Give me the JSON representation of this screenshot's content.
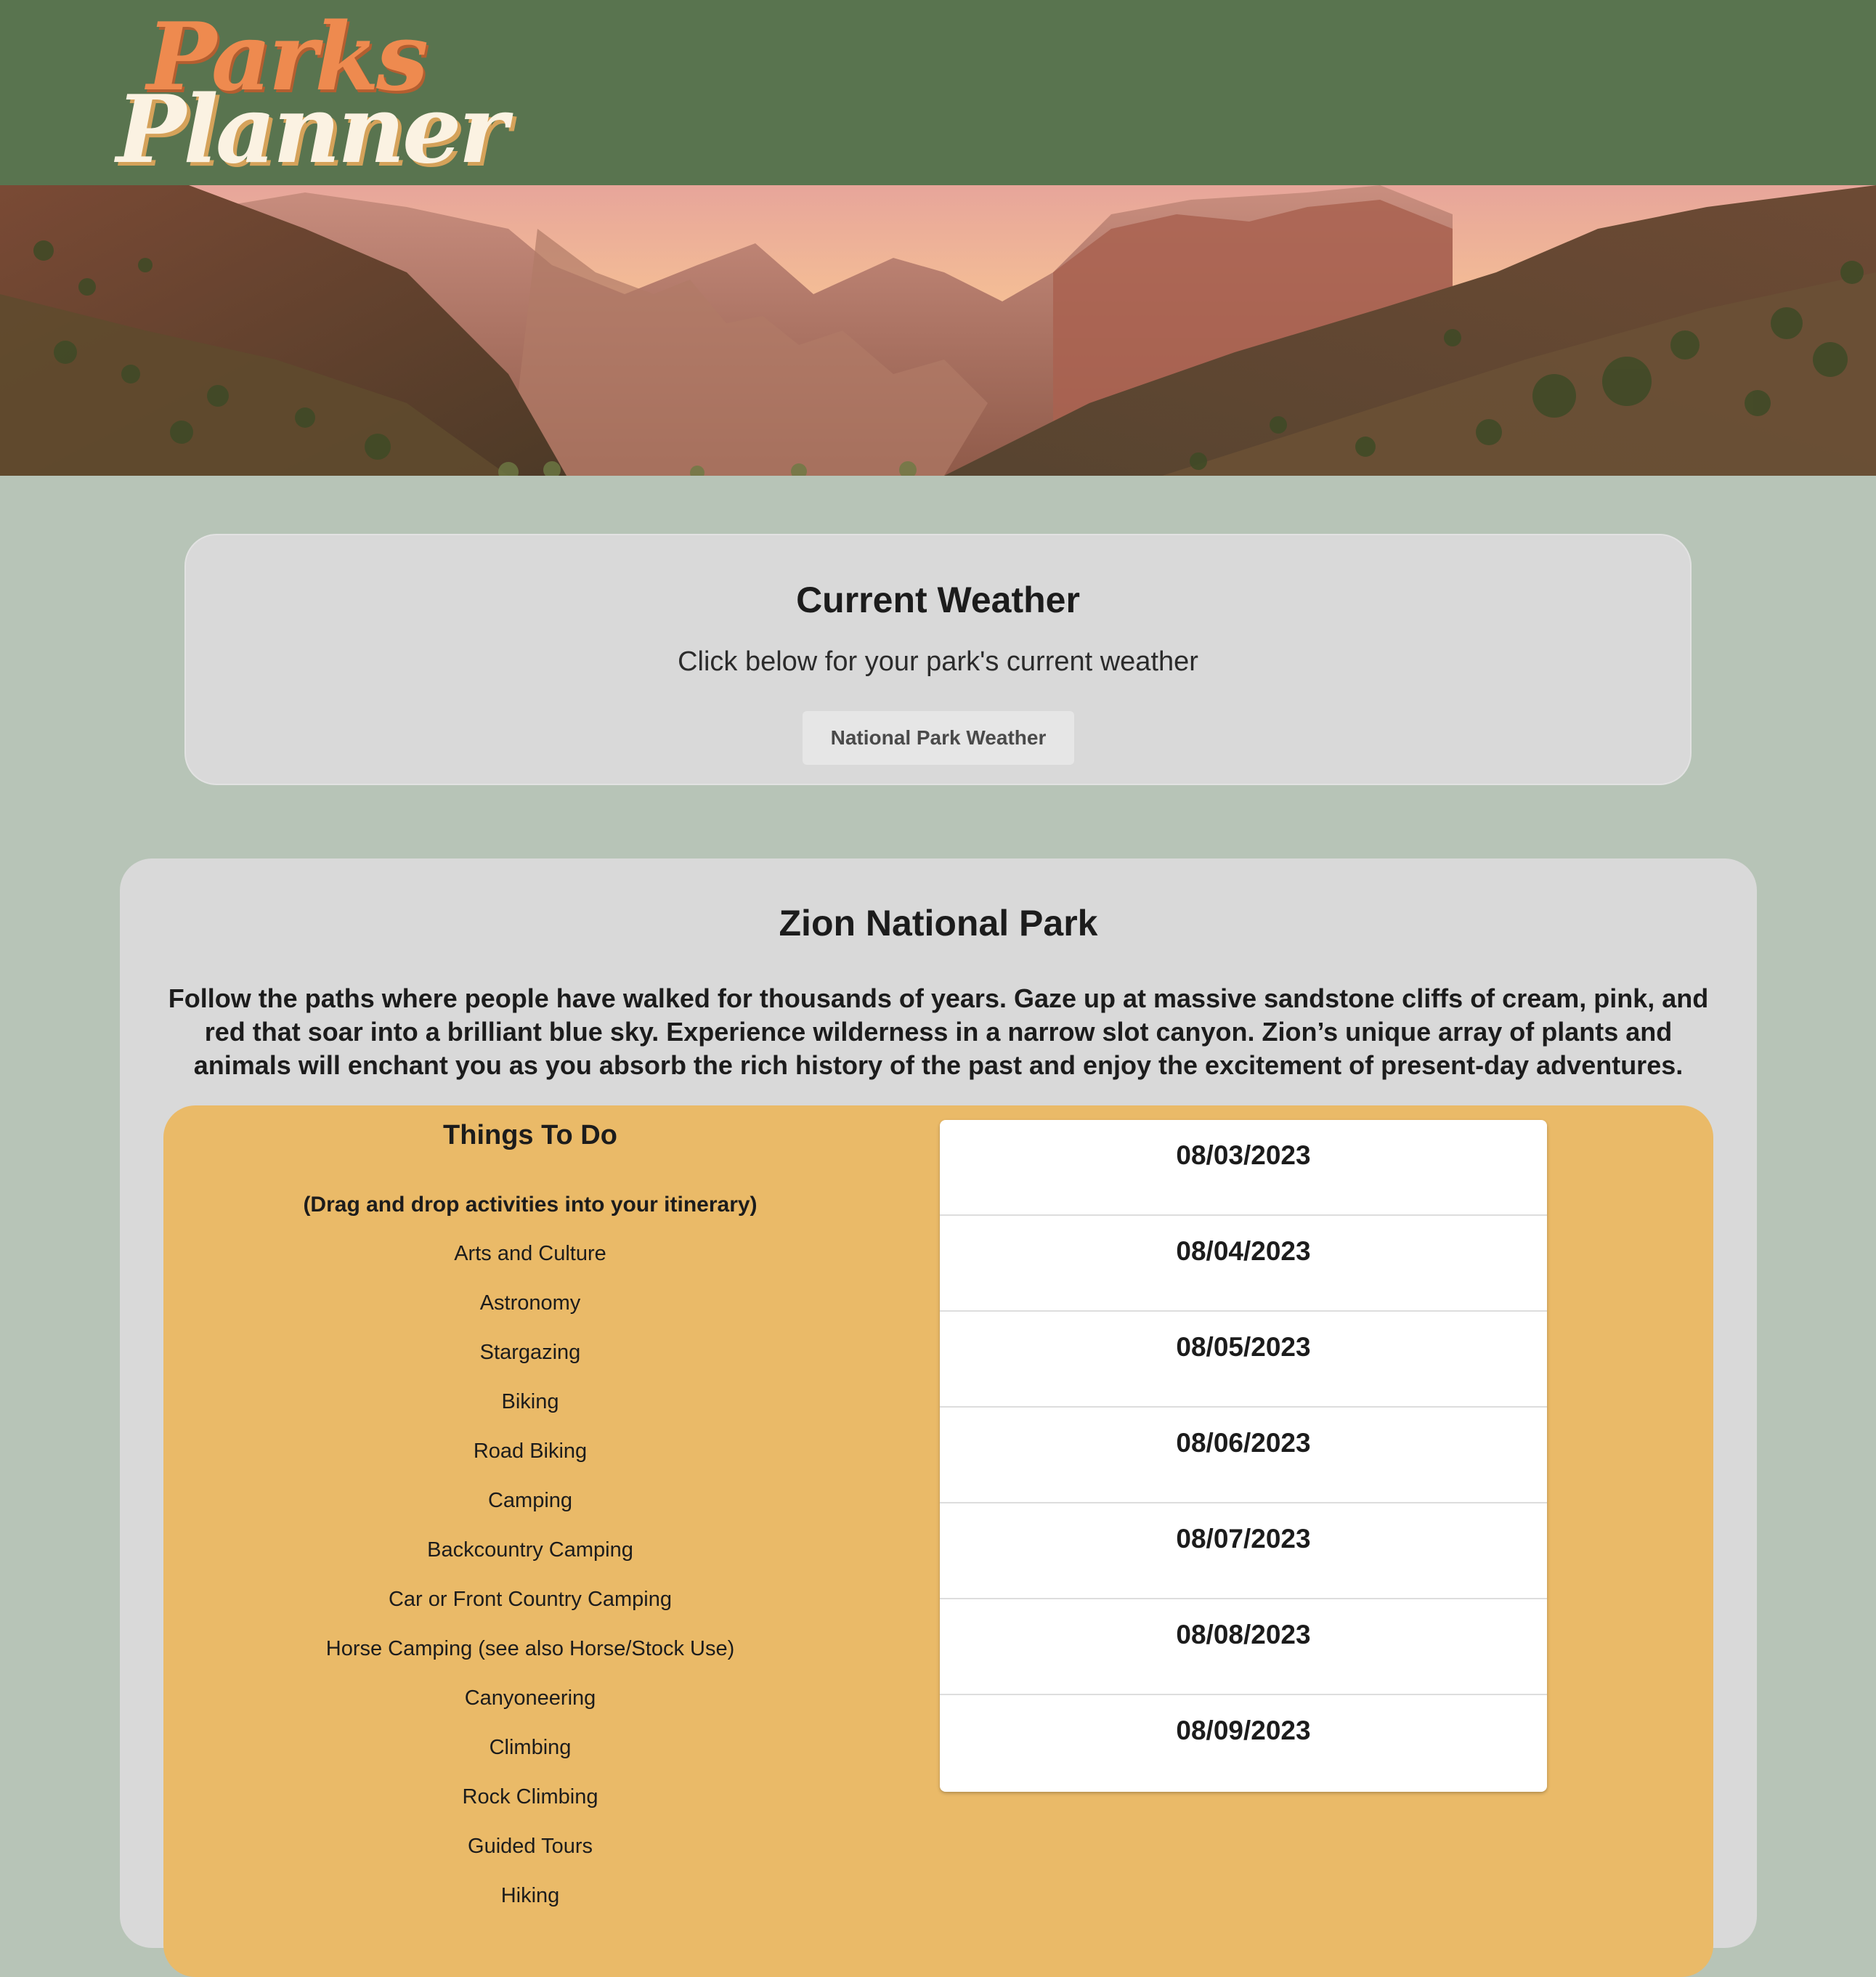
{
  "header": {
    "logo_line1": "Parks",
    "logo_line2": "Planner",
    "background_color": "#59744f",
    "logo_primary_color": "#ee8a4f",
    "logo_secondary_color": "#fbf2e2"
  },
  "banner": {
    "image": "canyon-landscape"
  },
  "weather": {
    "title": "Current Weather",
    "subtitle": "Click below for your park's current weather",
    "button_label": "National Park Weather"
  },
  "park": {
    "name": "Zion National Park",
    "description": "Follow the paths where people have walked for thousands of years. Gaze up at massive sandstone cliffs of cream, pink, and red that soar into a brilliant blue sky. Experience wilderness in a narrow slot canyon. Zion’s unique array of plants and animals will enchant you as you absorb the rich history of the past and enjoy the excitement of present-day adventures."
  },
  "things_to_do": {
    "title": "Things To Do",
    "hint": "(Drag and drop activities into your itinerary)",
    "items": [
      "Arts and Culture",
      "Astronomy",
      "Stargazing",
      "Biking",
      "Road Biking",
      "Camping",
      "Backcountry Camping",
      "Car or Front Country Camping",
      "Horse Camping (see also Horse/Stock Use)",
      "Canyoneering",
      "Climbing",
      "Rock Climbing",
      "Guided Tours",
      "Hiking"
    ],
    "panel_color": "#eaba68"
  },
  "itinerary": {
    "days": [
      "08/03/2023",
      "08/04/2023",
      "08/05/2023",
      "08/06/2023",
      "08/07/2023",
      "08/08/2023",
      "08/09/2023"
    ]
  }
}
